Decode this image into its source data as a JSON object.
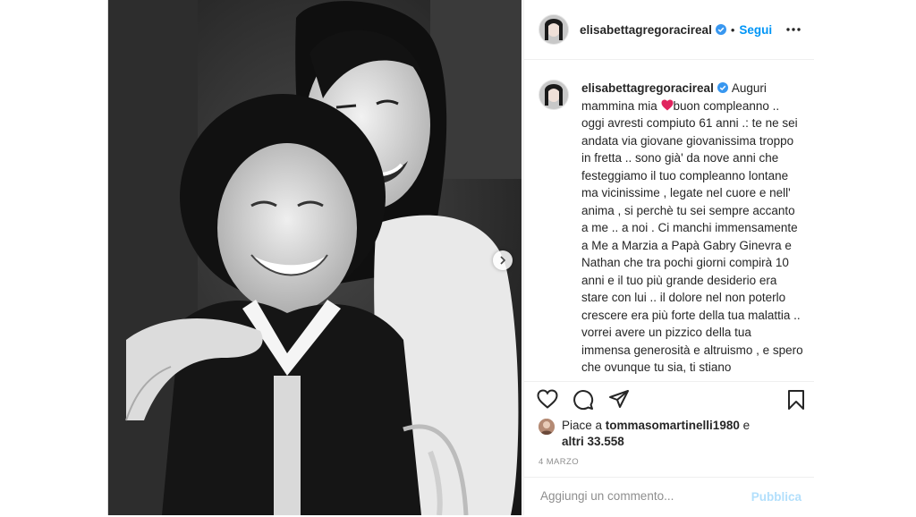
{
  "post": {
    "username": "elisabettagregoracireal",
    "follow_label": "Segui",
    "caption": {
      "username": "elisabettagregoracireal",
      "text_before_heart": "Auguri mammina mia ",
      "text_after_heart": "buon compleanno .. oggi avresti compiuto 61 anni .: te ne sei andata via giovane giovanissima troppo in fretta .. sono già' da nove anni che festeggiamo il tuo compleanno lontane ma vicinissime , legate nel cuore e nell' anima , si perchè tu sei sempre accanto a me .. a noi . Ci manchi immensamente a Me a Marzia a Papà Gabry Ginevra e Nathan che tra pochi giorni compirà 10 anni e il tuo più grande desiderio era stare con lui .. il dolore nel non poterlo crescere era più forte della tua malattia .. vorrei avere un pizzico della tua immensa generosità e altruismo , e spero che ovunque tu sia, ti stiano festeggiando al meglio come meriti .. mammina mia"
    },
    "likes": {
      "prefix": "Piace a ",
      "user": "tommasomartinelli1980",
      "conjunction": " e",
      "others": "altri 33.558"
    },
    "date": "4 MARZO",
    "comment_placeholder": "Aggiungi un commento...",
    "publish_label": "Pubblica"
  },
  "icons": {
    "verified": "verified-badge-icon",
    "more": "more-dots-icon",
    "like": "heart-icon",
    "comment": "comment-icon",
    "share": "paper-plane-icon",
    "save": "bookmark-icon",
    "next": "chevron-right-icon",
    "heart_emoji": "red-heart-emoji-icon"
  },
  "colors": {
    "link_blue": "#0095f6",
    "publish_disabled": "#b2dffc",
    "text": "#262626",
    "muted": "#8e8e8e",
    "verified": "#3897f0",
    "heart": "#e0245e"
  }
}
